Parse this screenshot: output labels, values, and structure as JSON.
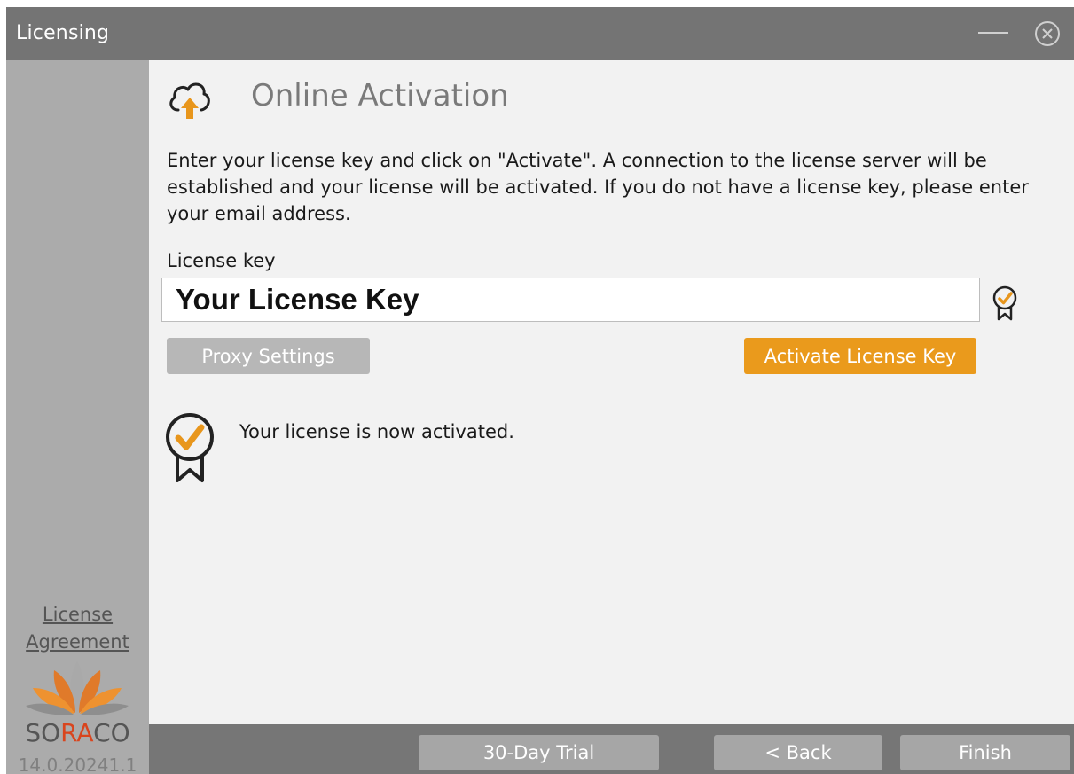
{
  "window": {
    "title": "Licensing"
  },
  "sidebar": {
    "license_agreement_line1": "License",
    "license_agreement_line2": "Agreement",
    "logo_text_part1": "SO",
    "logo_text_part2": "RA",
    "logo_text_part3": "CO",
    "version": "14.0.20241.1"
  },
  "main": {
    "header_icon": "cloud-upload-icon",
    "heading": "Online Activation",
    "description": "Enter your license key and click on \"Activate\". A connection to the license server will be established and your license will be activated. If you do not have a license key, please enter your email address.",
    "license_key_label": "License key",
    "license_key_value": "Your License Key",
    "license_key_status_icon": "certificate-badge-icon",
    "proxy_button_label": "Proxy Settings",
    "activate_button_label": "Activate License Key",
    "status_icon": "certificate-badge-icon",
    "status_message": "Your license is now activated."
  },
  "footer": {
    "trial_button_label": "30-Day Trial",
    "back_button_label": "< Back",
    "finish_button_label": "Finish"
  },
  "colors": {
    "title_bar": "#747474",
    "sidebar": "#ababab",
    "content_bg": "#f2f2f2",
    "accent_orange": "#ea9a1c",
    "button_gray": "#a6a6a6",
    "footer": "#767676"
  }
}
